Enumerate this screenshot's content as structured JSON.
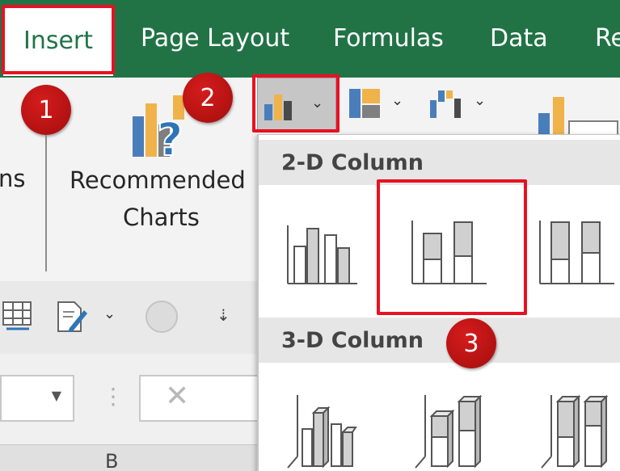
{
  "ribbon_tabs": {
    "insert": "Insert",
    "page_layout": "Page Layout",
    "formulas": "Formulas",
    "data": "Data",
    "review_partial": "Re"
  },
  "ribbon": {
    "partial_label": "ns",
    "recommended_charts_line1": "Recommended",
    "recommended_charts_line2": "Charts"
  },
  "steps": [
    "1",
    "2",
    "3"
  ],
  "chart_gallery": {
    "section_2d": "2-D Column",
    "section_3d": "3-D Column",
    "items_2d": [
      "clustered-column",
      "stacked-column",
      "100-stacked-column"
    ],
    "items_3d": [
      "3d-clustered-column",
      "3d-stacked-column",
      "3d-100-stacked-column"
    ]
  },
  "colors": {
    "excel_green": "#217346",
    "highlight_red": "#e81123",
    "chart_blue": "#4a7ebb",
    "chart_gold": "#f0b34a",
    "chart_gray": "#7f7f7f"
  },
  "column_header_partial": "B"
}
